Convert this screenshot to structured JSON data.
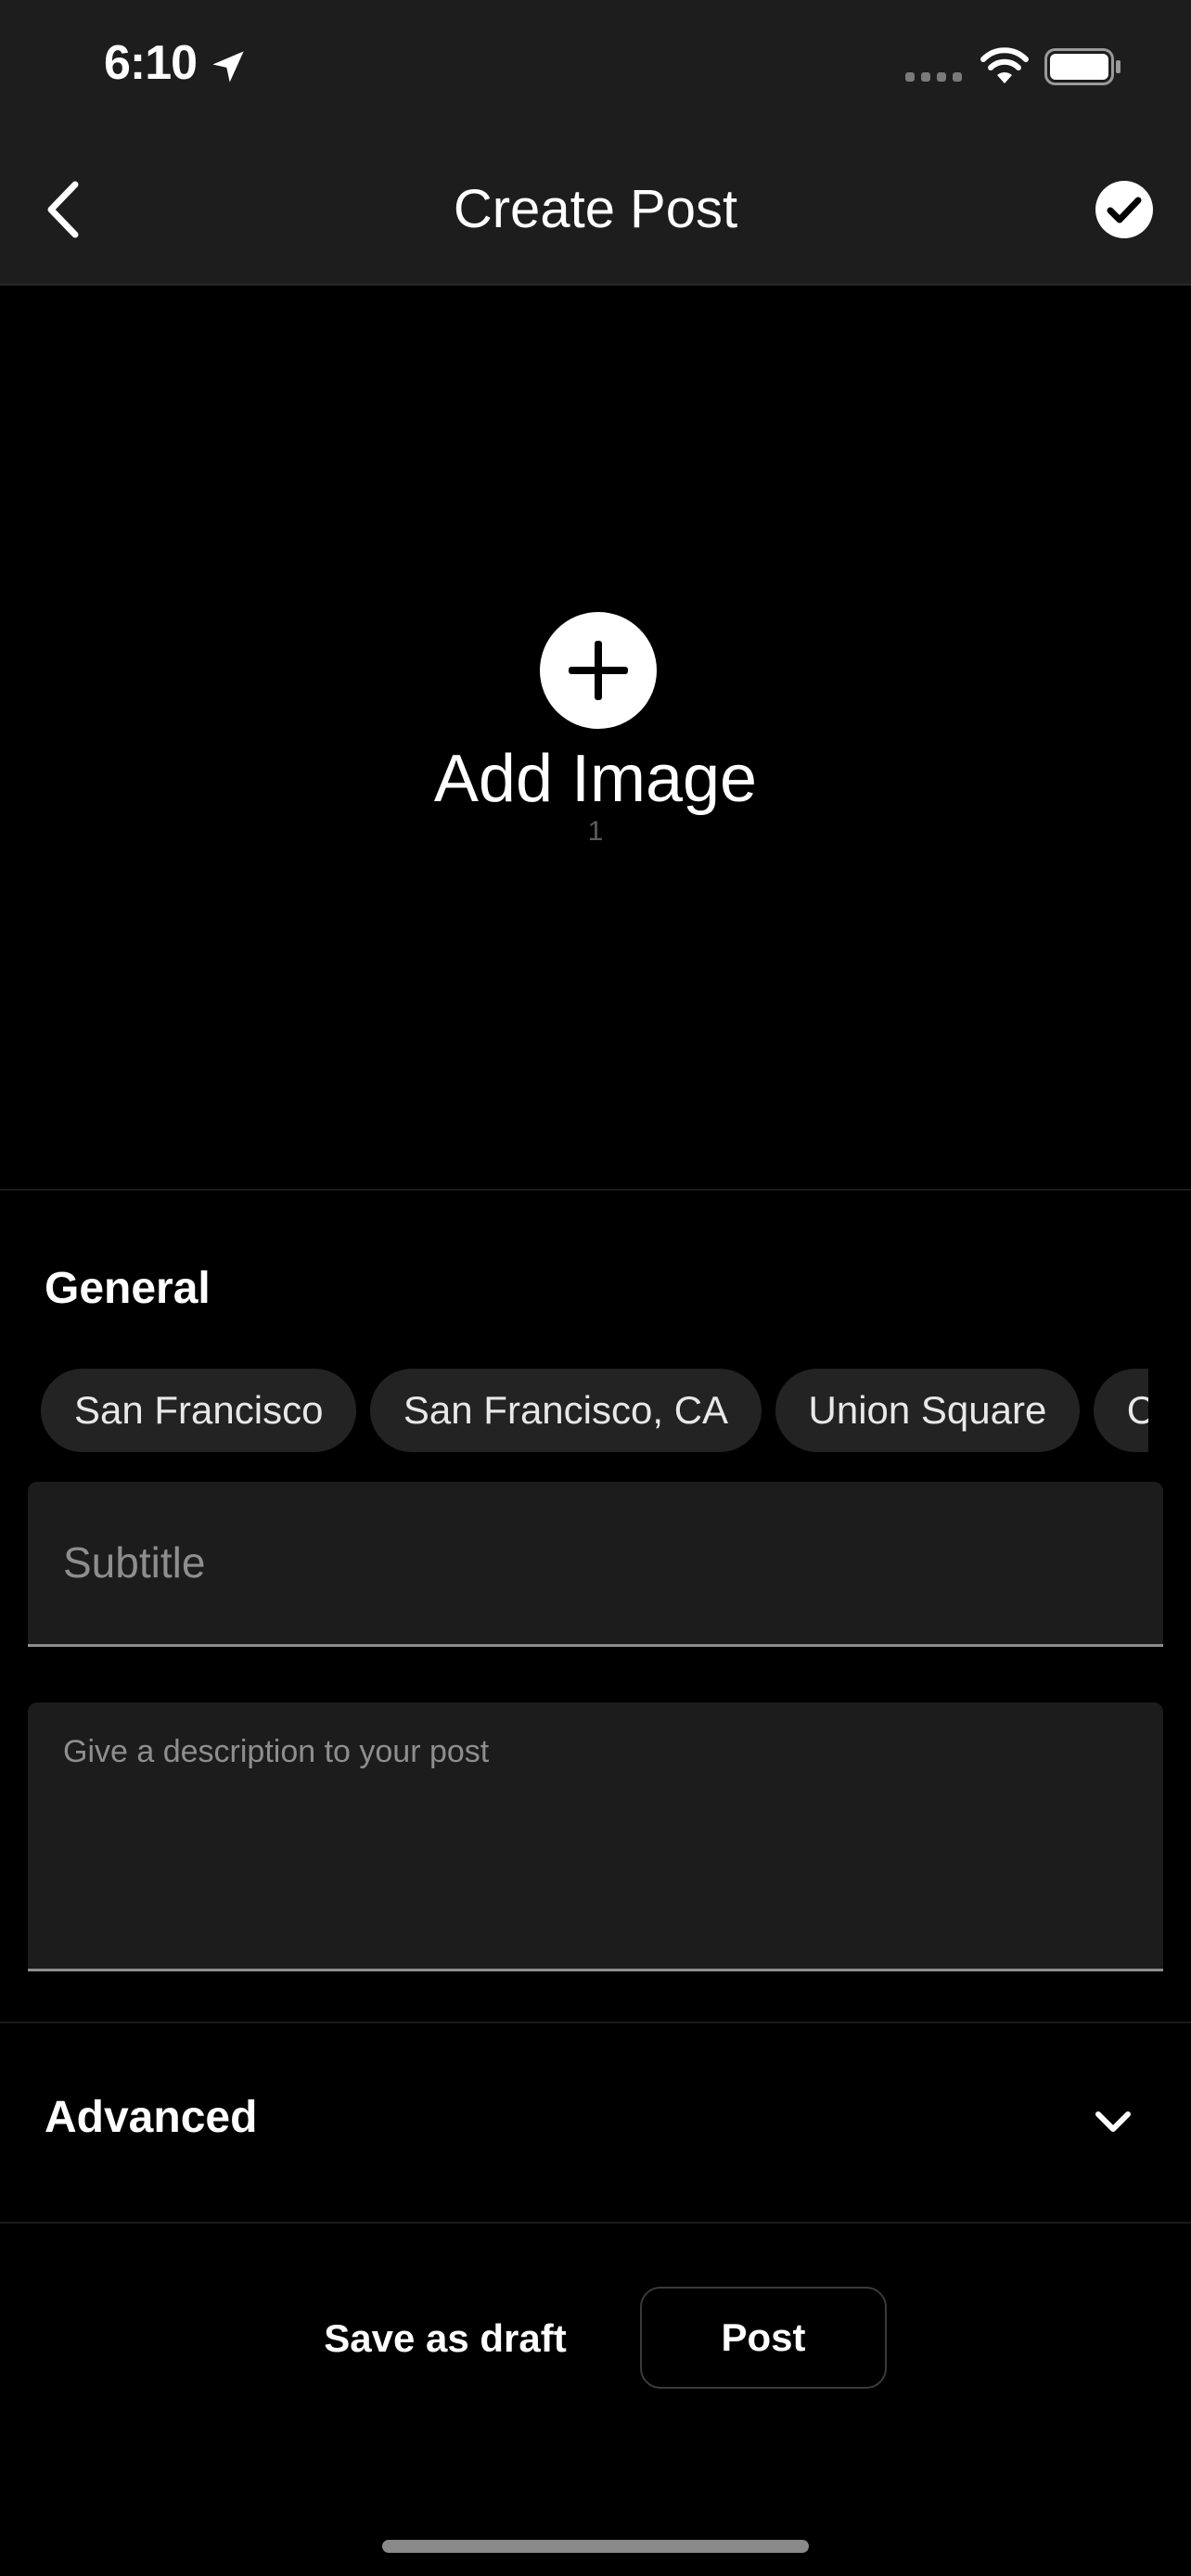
{
  "status_bar": {
    "time": "6:10",
    "icons": [
      "location-arrow-icon",
      "signal-icon",
      "wifi-icon",
      "battery-icon"
    ]
  },
  "nav": {
    "title": "Create Post",
    "back_icon": "chevron-left-icon",
    "done_icon": "check-circle-icon"
  },
  "image_area": {
    "add_label": "Add Image",
    "count": "1",
    "icon": "plus-circle-icon"
  },
  "general": {
    "title": "General",
    "location_chips": [
      "San Francisco",
      "San Francisco, CA",
      "Union Square",
      "C"
    ],
    "subtitle_placeholder": "Subtitle",
    "subtitle_value": "",
    "description_placeholder": "Give a description to your post",
    "description_value": ""
  },
  "advanced": {
    "label": "Advanced",
    "icon": "chevron-down-icon"
  },
  "actions": {
    "save_draft_label": "Save as draft",
    "post_label": "Post"
  },
  "colors": {
    "background": "#000000",
    "bar": "#1d1d1d",
    "chip": "#232323",
    "field": "#1c1c1c",
    "muted_text": "#8e8e8e"
  }
}
